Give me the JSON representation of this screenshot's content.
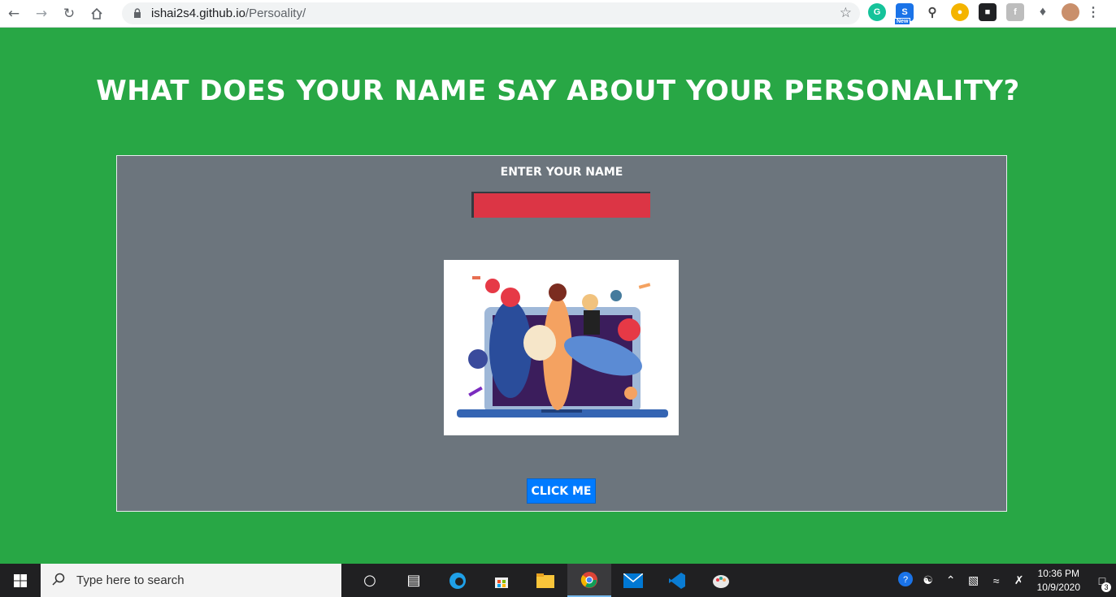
{
  "browser": {
    "url_host": "ishai2s4.github.io",
    "url_path": "/Persoality/"
  },
  "page": {
    "title": "What does your name say about your personality?",
    "input_label": "Enter your name",
    "input_value": "",
    "button_label": "Click Me"
  },
  "colors": {
    "page_bg": "#28a745",
    "card_bg": "#6c757d",
    "input_bg": "#dc3545",
    "button_bg": "#007bff"
  },
  "taskbar": {
    "search_placeholder": "Type here to search",
    "time": "10:36 PM",
    "date": "10/9/2020",
    "notification_count": "3"
  }
}
